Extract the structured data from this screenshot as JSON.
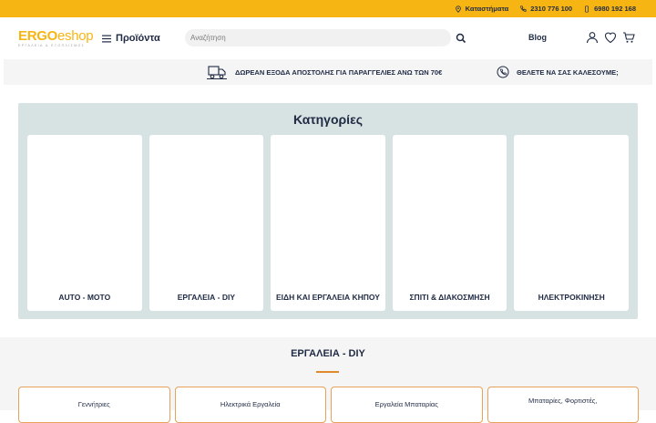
{
  "topbar": {
    "stores": "Καταστήματα",
    "phone1": "2310 776 100",
    "phone2": "6980 192 168"
  },
  "header": {
    "logo_ergo": "ERGO",
    "logo_eshop": "eshop",
    "logo_tagline": "ΕΡΓΑΛΕΙΑ & ΕΞΟΠΛΙΣΜΟΣ",
    "menu_label": "Προϊόντα",
    "search_placeholder": "Αναζήτηση",
    "blog_label": "Blog"
  },
  "shipbar": {
    "free_shipping": "ΔΩΡΕΑΝ ΕΞΟΔΑ ΑΠΟΣΤΟΛΗΣ ΓΙΑ ΠΑΡΑΓΓΕΛΙΕΣ ΑΝΩ ΤΩΝ 70€",
    "callback": "ΘΕΛΕΤΕ ΝΑ ΣΑΣ ΚΑΛΕΣΟΥΜΕ;"
  },
  "categories": {
    "title": "Κατηγορίες",
    "items": [
      {
        "label": "AUTO - MOTO"
      },
      {
        "label": "ΕΡΓΑΛΕΙΑ - DIY"
      },
      {
        "label": "ΕΙΔΗ ΚΑΙ ΕΡΓΑΛΕΙΑ ΚΗΠΟΥ"
      },
      {
        "label": "ΣΠΙΤΙ & ΔΙΑΚΟΣΜΗΣΗ"
      },
      {
        "label": "ΗΛΕΚΤΡΟΚΙΝΗΣΗ"
      }
    ]
  },
  "section": {
    "title": "ΕΡΓΑΛΕΙΑ - DIY",
    "items": [
      {
        "label": "Γεννήτριες"
      },
      {
        "label": "Ηλεκτρικά Εργαλεία"
      },
      {
        "label": "Εργαλεία Μπαταρίας"
      },
      {
        "label": "Μπαταρίες, Φορτιστές,"
      }
    ]
  },
  "colors": {
    "accent": "#f7b514",
    "category_bg": "#d7e2e2",
    "divider": "#e08a2a",
    "text_dark": "#1f2a44"
  },
  "icons": {
    "topbar": [
      "location-pin-icon",
      "phone-icon",
      "mobile-icon"
    ],
    "header": [
      "hamburger-icon",
      "search-icon",
      "user-icon",
      "heart-icon",
      "cart-icon"
    ],
    "shipbar": [
      "truck-icon",
      "phone-call-icon"
    ]
  }
}
